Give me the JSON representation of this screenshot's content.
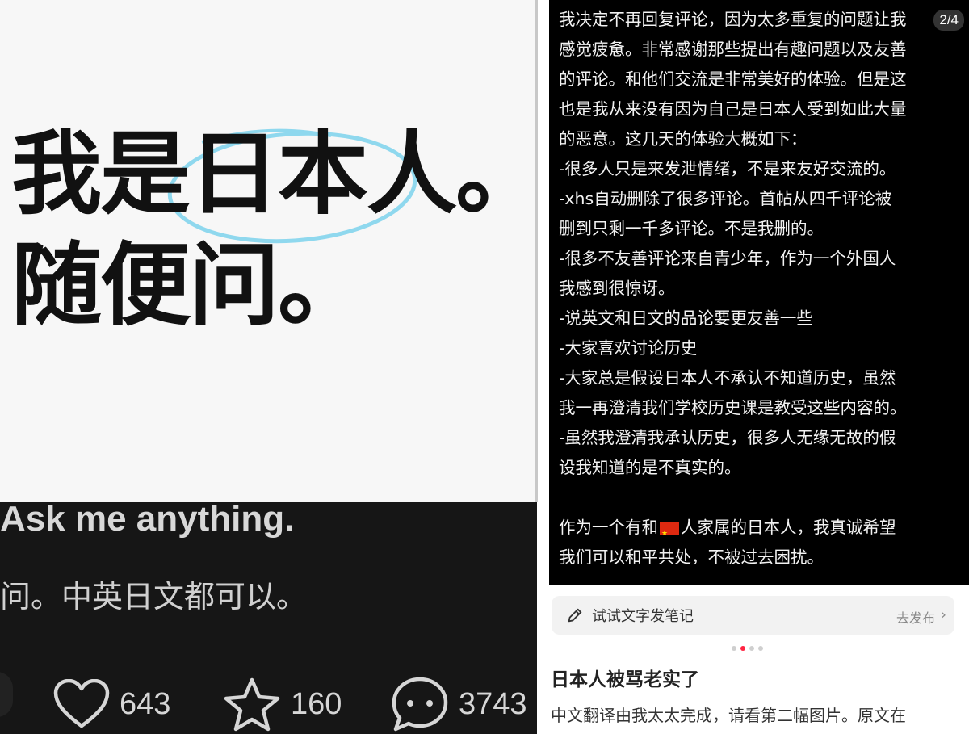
{
  "left_post": {
    "image": {
      "headline_line1": "我是日本人。",
      "headline_line2": "随便问。",
      "circle_color": "#8fd8ee"
    },
    "caption_en": "Ask me anything.",
    "caption_zh": "问。中英日文都可以。",
    "stats": {
      "likes": "643",
      "favorites": "160",
      "comments": "3743"
    }
  },
  "right_post": {
    "page_indicator": "2/4",
    "image_text": {
      "lines": [
        "我决定不再回复评论，因为太多重复的问题让我",
        "感觉疲惫。非常感谢那些提出有趣问题以及友善",
        "的评论。和他们交流是非常美好的体验。但是这",
        "也是我从来没有因为自己是日本人受到如此大量",
        "的恶意。这几天的体验大概如下：",
        "-很多人只是来发泄情绪，不是来友好交流的。",
        "-xhs自动删除了很多评论。首帖从四千评论被",
        "删到只剩一千多评论。不是我删的。",
        "-很多不友善评论来自青少年，作为一个外国人",
        "我感到很惊讶。",
        "-说英文和日文的品论要更友善一些",
        "-大家喜欢讨论历史",
        "-大家总是假设日本人不承认不知道历史，虽然",
        "我一再澄清我们学校历史课是教受这些内容的。",
        "-虽然我澄清我承认历史，很多人无缘无故的假",
        "设我知道的是不真实的。"
      ],
      "closing_before_flag": "作为一个有和",
      "flag_icon": "china-flag-icon",
      "closing_after_flag": "人家属的日本人，我真诚希望",
      "closing_line2": "我们可以和平共处，不被过去困扰。"
    },
    "try_bar": {
      "icon": "pen-icon",
      "label": "试试文字发笔记",
      "action": "去发布"
    },
    "carousel": {
      "count": 4,
      "active_index": 1
    },
    "note_title": "日本人被骂老实了",
    "note_description": "中文翻译由我太太完成，请看第二幅图片。原文在"
  },
  "colors": {
    "accent_red": "#ff2442",
    "dark_bg": "#161616"
  }
}
